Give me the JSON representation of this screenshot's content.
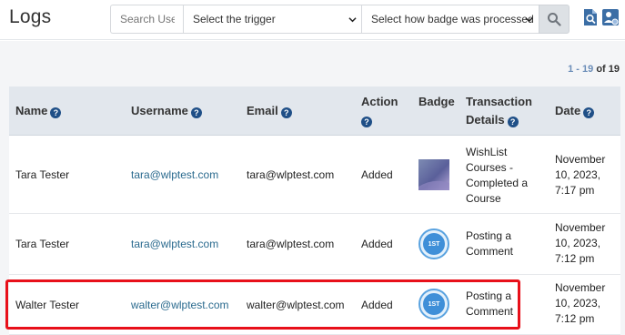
{
  "header": {
    "title": "Logs",
    "search_placeholder": "Search Use",
    "trigger_select": "Select the trigger",
    "badge_select": "Select how badge was processed"
  },
  "pagination": {
    "range": "1 - 19",
    "of_label": "of 19"
  },
  "table": {
    "columns": {
      "name": "Name",
      "username": "Username",
      "email": "Email",
      "action": "Action",
      "badge": "Badge",
      "transaction_1": "Transaction",
      "transaction_2": "Details",
      "date": "Date"
    },
    "rows": [
      {
        "name": "Tara Tester",
        "username": "tara@wlptest.com",
        "email": "tara@wlptest.com",
        "action": "Added",
        "badge_label": "",
        "details": [
          "WishList",
          "Courses -",
          "Completed a",
          "Course"
        ],
        "date": [
          "November",
          "10, 2023,",
          "7:17 pm"
        ]
      },
      {
        "name": "Tara Tester",
        "username": "tara@wlptest.com",
        "email": "tara@wlptest.com",
        "action": "Added",
        "badge_label": "1ST",
        "details": [
          "Posting a",
          "Comment"
        ],
        "date": [
          "November",
          "10, 2023,",
          "7:12 pm"
        ]
      },
      {
        "name": "Walter Tester",
        "username": "walter@wlptest.com",
        "email": "walter@wlptest.com",
        "action": "Added",
        "badge_label": "1ST",
        "details": [
          "Posting a",
          "Comment"
        ],
        "date": [
          "November",
          "10, 2023,",
          "7:12 pm"
        ]
      }
    ]
  },
  "colors": {
    "accent": "#1f4f87",
    "link": "#2a6a8e",
    "highlight": "#e8101a",
    "badge_blue": "#3f8fd8"
  },
  "icons": {
    "search": "search-icon",
    "help": "help-icon",
    "export": "export-icon",
    "user_settings": "user-settings-icon",
    "dropdown": "chevron-down-icon"
  }
}
